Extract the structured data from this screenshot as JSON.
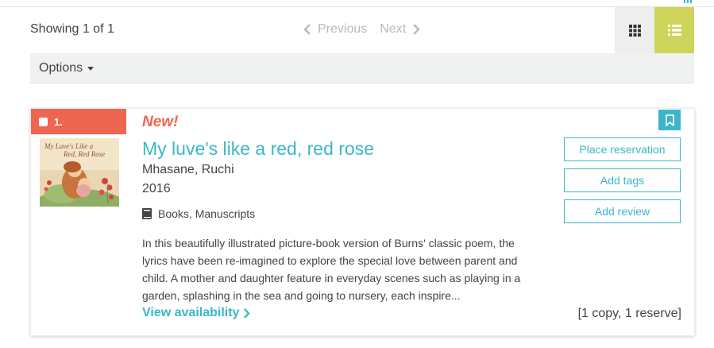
{
  "toolbar": {
    "showing": "Showing 1 of 1",
    "previous": "Previous",
    "next": "Next",
    "view_grid_icon": "grid-icon",
    "view_list_icon": "list-icon",
    "active_view_color": "#cfd45a"
  },
  "options": {
    "label": "Options"
  },
  "result": {
    "number": "1.",
    "new_label": "New!",
    "title": "My luve's like a red, red rose",
    "author": "Mhasane, Ruchi",
    "year": "2016",
    "format_icon": "book-icon",
    "format": "Books, Manuscripts",
    "summary": "In this beautifully illustrated picture-book version of Burns' classic poem, the lyrics have been re-imagined to explore the special love between parent and child. A mother and daughter feature in everyday scenes such as playing in a garden, splashing in the sea and going to nursery, each inspire...",
    "view_availability": "View availability",
    "copies": "[1 copy, 1 reserve]",
    "actions": {
      "place_reservation": "Place reservation",
      "add_tags": "Add tags",
      "add_review": "Add review"
    },
    "cover": {
      "line1": "My Luve's Like a",
      "line2": "Red, Red Rose"
    },
    "colors": {
      "accent": "#3ab7c9",
      "badge": "#ef6650"
    }
  }
}
